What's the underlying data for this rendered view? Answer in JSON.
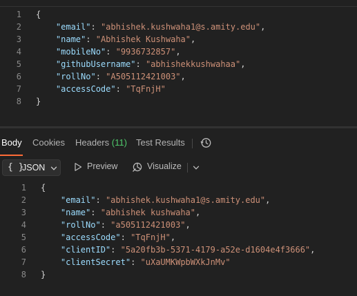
{
  "request_body": {
    "lines": [
      {
        "num": "1",
        "indent": 0,
        "parts": [
          {
            "t": "punc",
            "v": "{"
          }
        ]
      },
      {
        "num": "2",
        "indent": 4,
        "parts": [
          {
            "t": "key",
            "v": "\"email\""
          },
          {
            "t": "punc",
            "v": ": "
          },
          {
            "t": "str",
            "v": "\"abhishek.kushwaha1@s.amity.edu\""
          },
          {
            "t": "punc",
            "v": ","
          }
        ]
      },
      {
        "num": "3",
        "indent": 4,
        "parts": [
          {
            "t": "key",
            "v": "\"name\""
          },
          {
            "t": "punc",
            "v": ": "
          },
          {
            "t": "str",
            "v": "\"Abhishek Kushwaha\""
          },
          {
            "t": "punc",
            "v": ","
          }
        ]
      },
      {
        "num": "4",
        "indent": 4,
        "parts": [
          {
            "t": "key",
            "v": "\"mobileNo\""
          },
          {
            "t": "punc",
            "v": ": "
          },
          {
            "t": "str",
            "v": "\"9936732857\""
          },
          {
            "t": "punc",
            "v": ","
          }
        ]
      },
      {
        "num": "5",
        "indent": 4,
        "parts": [
          {
            "t": "key",
            "v": "\"githubUsername\""
          },
          {
            "t": "punc",
            "v": ": "
          },
          {
            "t": "str",
            "v": "\"abhishekkushwahaa\""
          },
          {
            "t": "punc",
            "v": ","
          }
        ]
      },
      {
        "num": "6",
        "indent": 4,
        "parts": [
          {
            "t": "key",
            "v": "\"rollNo\""
          },
          {
            "t": "punc",
            "v": ": "
          },
          {
            "t": "str",
            "v": "\"A505112421003\""
          },
          {
            "t": "punc",
            "v": ","
          }
        ]
      },
      {
        "num": "7",
        "indent": 4,
        "parts": [
          {
            "t": "key",
            "v": "\"accessCode\""
          },
          {
            "t": "punc",
            "v": ": "
          },
          {
            "t": "str",
            "v": "\"TqFnjH\""
          }
        ]
      },
      {
        "num": "8",
        "indent": 0,
        "parts": [
          {
            "t": "punc",
            "v": "}"
          }
        ]
      }
    ]
  },
  "response_tabs": {
    "body": "Body",
    "cookies": "Cookies",
    "headers": "Headers",
    "headers_count": "(11)",
    "test_results": "Test Results",
    "history_icon": "history-icon"
  },
  "toolbar": {
    "format_braces": "{ }",
    "format_label": "JSON",
    "preview_label": "Preview",
    "visualize_label": "Visualize"
  },
  "response_body": {
    "lines": [
      {
        "num": "1",
        "indent": 0,
        "parts": [
          {
            "t": "punc",
            "v": "{"
          }
        ]
      },
      {
        "num": "2",
        "indent": 4,
        "parts": [
          {
            "t": "key",
            "v": "\"email\""
          },
          {
            "t": "punc",
            "v": ": "
          },
          {
            "t": "str",
            "v": "\"abhishek.kushwaha1@s.amity.edu\""
          },
          {
            "t": "punc",
            "v": ","
          }
        ]
      },
      {
        "num": "3",
        "indent": 4,
        "parts": [
          {
            "t": "key",
            "v": "\"name\""
          },
          {
            "t": "punc",
            "v": ": "
          },
          {
            "t": "str",
            "v": "\"abhishek kushwaha\""
          },
          {
            "t": "punc",
            "v": ","
          }
        ]
      },
      {
        "num": "4",
        "indent": 4,
        "parts": [
          {
            "t": "key",
            "v": "\"rollNo\""
          },
          {
            "t": "punc",
            "v": ": "
          },
          {
            "t": "str",
            "v": "\"a505112421003\""
          },
          {
            "t": "punc",
            "v": ","
          }
        ]
      },
      {
        "num": "5",
        "indent": 4,
        "parts": [
          {
            "t": "key",
            "v": "\"accessCode\""
          },
          {
            "t": "punc",
            "v": ": "
          },
          {
            "t": "str",
            "v": "\"TqFnjH\""
          },
          {
            "t": "punc",
            "v": ","
          }
        ]
      },
      {
        "num": "6",
        "indent": 4,
        "parts": [
          {
            "t": "key",
            "v": "\"clientID\""
          },
          {
            "t": "punc",
            "v": ": "
          },
          {
            "t": "str",
            "v": "\"5a20fb3b-5371-4179-a52e-d1604e4f3666\""
          },
          {
            "t": "punc",
            "v": ","
          }
        ]
      },
      {
        "num": "7",
        "indent": 4,
        "parts": [
          {
            "t": "key",
            "v": "\"clientSecret\""
          },
          {
            "t": "punc",
            "v": ": "
          },
          {
            "t": "str",
            "v": "\"uXaUMKWpbWXkJnMv\""
          }
        ]
      },
      {
        "num": "8",
        "indent": 0,
        "parts": [
          {
            "t": "punc",
            "v": "}"
          }
        ]
      }
    ]
  },
  "colors": {
    "background": "#212121",
    "accent_tab": "#ff6c37",
    "json_key": "#9cdcfe",
    "json_string": "#ce9178",
    "count_green": "#4fc96b"
  }
}
